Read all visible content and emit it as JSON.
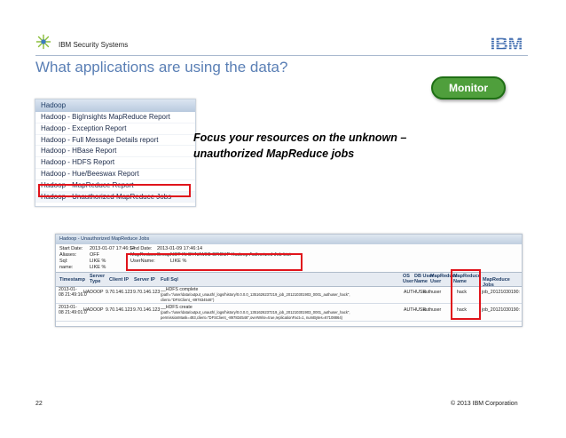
{
  "header": {
    "company": "IBM Security Systems",
    "logo_text": "IBM"
  },
  "slide": {
    "title": "What applications are using the data?",
    "badge": "Monitor",
    "callout_line1": "Focus your resources on the unknown –",
    "callout_line2": "unauthorized MapReduce jobs",
    "page_number": "22",
    "copyright": "© 2013 IBM Corporation"
  },
  "report_menu": {
    "title": "Hadoop",
    "items": [
      {
        "label": "Hadoop - BigInsights MapReduce Report"
      },
      {
        "label": "Hadoop - Exception Report"
      },
      {
        "label": "Hadoop - Full Message Details report"
      },
      {
        "label": "Hadoop - HBase Report"
      },
      {
        "label": "Hadoop - HDFS Report"
      },
      {
        "label": "Hadoop - Hue/Beeswax Report"
      },
      {
        "label": "Hadoop - MapReduce Report"
      },
      {
        "label": "Hadoop - Unauthorized MapReduce Jobs"
      }
    ],
    "selected_index": 7
  },
  "jobs_report": {
    "title": "Hadoop - Unauthorized MapReduce Jobs",
    "filters": {
      "start_date_label": "Start Date:",
      "start_date": "2013-01-07 17:46:14",
      "end_date_label": "End Date:",
      "end_date": "2013-01-09 17:46:14",
      "aliases_label": "Aliases:",
      "aliases": "OFF",
      "sql_label": "Sql:",
      "sql": "LIKE %",
      "name_label": "name:",
      "name": "LIKE %",
      "group_label": "MapReduceGroup:",
      "group": "NOT IN DYNAMIC GROUP Hadoop Authorized Job List",
      "username_label": "UserName:",
      "username": "LIKE %"
    },
    "columns": {
      "timestamp": "Timestamp",
      "server_type_1": "Server",
      "server_type_2": "Type",
      "client_ip": "Client IP",
      "server_ip": "Server IP",
      "full_sql": "Full Sql",
      "os_user_1": "OS",
      "os_user_2": "User",
      "db_user_1": "DB User",
      "db_user_2": "Name",
      "mr_user_1": "MapReduce",
      "mr_user_2": "User",
      "mr_name_1": "MapReduce",
      "mr_name_2": "Name",
      "mr_job": "MapReduce Jobs"
    },
    "rows": [
      {
        "timestamp_1": "2013-01-",
        "timestamp_2": "08 21:49:16.0",
        "server_type": "HADOOP",
        "client_ip": "9.70.146.123",
        "server_ip": "9.70.146.123",
        "sql_1": "__HDFS complete",
        "sql_2": "(path=\"/user/data/output_unauth/_logs/history/0.0.0.0_1351626237219_job_201210301903_0001_authuser_hack\",",
        "sql_3": "client=\"DFSClient_-897834546\")",
        "db_user": "AUTHUSR",
        "mr_user": "authuser",
        "mr_name": "hack",
        "mr_job": "job_20121030190:"
      },
      {
        "timestamp_1": "2013-01-",
        "timestamp_2": "08 21:49:01.0",
        "server_type": "HADOOP",
        "client_ip": "9.70.146.123",
        "server_ip": "9.70.146.123",
        "sql_1": "__HDFS create",
        "sql_2": "(path=\"/user/data/output_unauth/_logs/history/0.0.0.0_1351626237219_job_201210301903_0001_authuser_hack\",",
        "sql_3": "permissionMask=493,client=\"DFSClient_-897834546\",overWrite=true,replicationFact=1, numBytes=67108864)",
        "db_user": "AUTHUSR",
        "mr_user": "authuser",
        "mr_name": "hack",
        "mr_job": "job_20121030190:"
      }
    ]
  },
  "colors": {
    "title_blue": "#5a7fb5",
    "badge_green": "#4f9f3c",
    "highlight_red": "#e0141b"
  },
  "icons": [
    "ibm-security-star-logo",
    "ibm-logo"
  ]
}
